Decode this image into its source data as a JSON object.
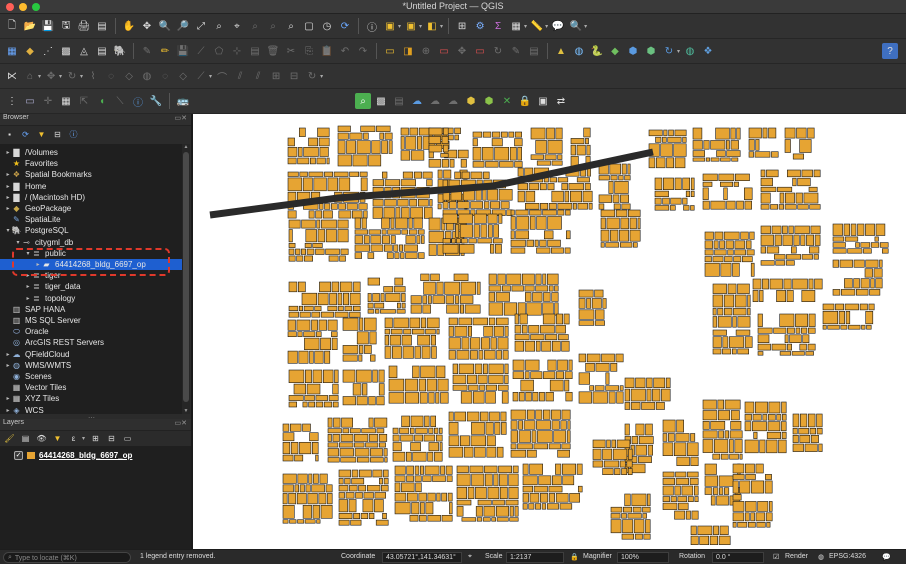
{
  "window": {
    "title": "*Untitled Project — QGIS"
  },
  "browser": {
    "title": "Browser",
    "items": [
      {
        "label": "/Volumes",
        "icon": "folder-icon",
        "glyph": "▇",
        "color": "#d8d8d8",
        "expander": "▸",
        "indent": 0
      },
      {
        "label": "Favorites",
        "icon": "star-icon",
        "glyph": "★",
        "color": "#f2c11b",
        "expander": "",
        "indent": 0
      },
      {
        "label": "Spatial Bookmarks",
        "icon": "bookmark-icon",
        "glyph": "❖",
        "color": "#caa24a",
        "expander": "▸",
        "indent": 0
      },
      {
        "label": "Home",
        "icon": "home-folder-icon",
        "glyph": "▇",
        "color": "#d8d8d8",
        "expander": "▸",
        "indent": 0
      },
      {
        "label": "/ (Macintosh HD)",
        "icon": "drive-icon",
        "glyph": "▇",
        "color": "#d8d8d8",
        "expander": "▸",
        "indent": 0
      },
      {
        "label": "GeoPackage",
        "icon": "geopackage-icon",
        "glyph": "◆",
        "color": "#c8a84a",
        "expander": "▸",
        "indent": 0
      },
      {
        "label": "SpatiaLite",
        "icon": "spatialite-icon",
        "glyph": "✎",
        "color": "#7aa7e0",
        "expander": "",
        "indent": 0
      },
      {
        "label": "PostgreSQL",
        "icon": "postgresql-icon",
        "glyph": "🐘",
        "color": "#6b9bd1",
        "expander": "▾",
        "indent": 0
      },
      {
        "label": "citygml_db",
        "icon": "database-connection-icon",
        "glyph": "⊸",
        "color": "#bbbbbb",
        "expander": "▾",
        "indent": 1
      },
      {
        "label": "public",
        "icon": "schema-icon",
        "glyph": "≣",
        "color": "#cfcfcf",
        "expander": "▾",
        "indent": 2
      },
      {
        "label": "64414268_bldg_6697_op",
        "icon": "polygon-layer-icon",
        "glyph": "▰",
        "color": "#e6e6e6",
        "expander": "▸",
        "indent": 3,
        "selected": true
      },
      {
        "label": "tiger",
        "icon": "schema-icon",
        "glyph": "≣",
        "color": "#cfcfcf",
        "expander": "▸",
        "indent": 2
      },
      {
        "label": "tiger_data",
        "icon": "schema-icon",
        "glyph": "≣",
        "color": "#cfcfcf",
        "expander": "▸",
        "indent": 2
      },
      {
        "label": "topology",
        "icon": "schema-icon",
        "glyph": "≣",
        "color": "#cfcfcf",
        "expander": "▸",
        "indent": 2
      },
      {
        "label": "SAP HANA",
        "icon": "sap-hana-icon",
        "glyph": "▥",
        "color": "#c7c7c7",
        "expander": "",
        "indent": 0
      },
      {
        "label": "MS SQL Server",
        "icon": "mssql-icon",
        "glyph": "▥",
        "color": "#c7c7c7",
        "expander": "",
        "indent": 0
      },
      {
        "label": "Oracle",
        "icon": "oracle-icon",
        "glyph": "⬭",
        "color": "#9ab8e8",
        "expander": "",
        "indent": 0
      },
      {
        "label": "ArcGIS REST Servers",
        "icon": "arcgis-icon",
        "glyph": "◎",
        "color": "#8fb0d8",
        "expander": "",
        "indent": 0
      },
      {
        "label": "QFieldCloud",
        "icon": "qfieldcloud-icon",
        "glyph": "☁",
        "color": "#8fb0d8",
        "expander": "▸",
        "indent": 0
      },
      {
        "label": "WMS/WMTS",
        "icon": "globe-icon",
        "glyph": "◍",
        "color": "#8fb0d8",
        "expander": "▸",
        "indent": 0
      },
      {
        "label": "Scenes",
        "icon": "scenes-icon",
        "glyph": "◉",
        "color": "#8fb0d8",
        "expander": "",
        "indent": 0
      },
      {
        "label": "Vector Tiles",
        "icon": "vector-tiles-icon",
        "glyph": "▦",
        "color": "#cccccc",
        "expander": "",
        "indent": 0
      },
      {
        "label": "XYZ Tiles",
        "icon": "xyz-tiles-icon",
        "glyph": "▦",
        "color": "#cccccc",
        "expander": "▸",
        "indent": 0
      },
      {
        "label": "WCS",
        "icon": "wcs-icon",
        "glyph": "◈",
        "color": "#8fb0d8",
        "expander": "▸",
        "indent": 0
      }
    ]
  },
  "layers": {
    "title": "Layers",
    "items": [
      {
        "label": "64414268_bldg_6697_op",
        "checked": true,
        "checkmark": "✓",
        "fill_color": "#e6a433"
      }
    ]
  },
  "statusbar": {
    "locate_placeholder": "Type to locate (⌘K)",
    "message": "1 legend entry removed.",
    "coordinate_label": "Coordinate",
    "coordinate_value": "43.05721°,141.34631°",
    "scale_label": "Scale",
    "scale_value": "1:2137",
    "magnifier_label": "Magnifier",
    "magnifier_value": "100%",
    "rotation_label": "Rotation",
    "rotation_value": "0.0 °",
    "render_label": "Render",
    "crs_value": "EPSG:4326"
  },
  "map": {
    "building_fill": "#e6a433",
    "building_stroke": "#1a1a1a",
    "road_color": "#2a2a2a"
  }
}
